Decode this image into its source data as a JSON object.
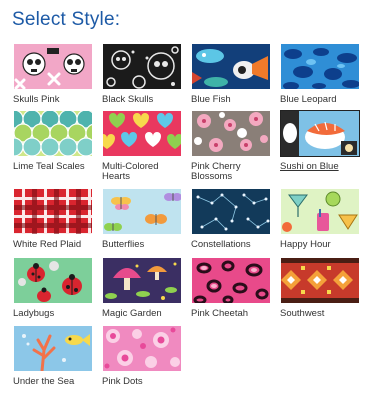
{
  "header": {
    "title": "Select Style:"
  },
  "styles": [
    {
      "label": "Skulls Pink",
      "icon": "skulls-pink-swatch",
      "selected": false
    },
    {
      "label": "Black Skulls",
      "icon": "black-skulls-swatch",
      "selected": false
    },
    {
      "label": "Blue Fish",
      "icon": "blue-fish-swatch",
      "selected": false
    },
    {
      "label": "Blue Leopard",
      "icon": "blue-leopard-swatch",
      "selected": false
    },
    {
      "label": "Lime Teal Scales",
      "icon": "lime-teal-scales-swatch",
      "selected": false
    },
    {
      "label": "Multi-Colored Hearts",
      "icon": "multi-colored-hearts-swatch",
      "selected": false
    },
    {
      "label": "Pink Cherry Blossoms",
      "icon": "pink-cherry-blossoms-swatch",
      "selected": false
    },
    {
      "label": "Sushi on Blue",
      "icon": "sushi-on-blue-swatch",
      "selected": true
    },
    {
      "label": "White Red Plaid",
      "icon": "white-red-plaid-swatch",
      "selected": false
    },
    {
      "label": "Butterflies",
      "icon": "butterflies-swatch",
      "selected": false
    },
    {
      "label": "Constellations",
      "icon": "constellations-swatch",
      "selected": false
    },
    {
      "label": "Happy Hour",
      "icon": "happy-hour-swatch",
      "selected": false
    },
    {
      "label": "Ladybugs",
      "icon": "ladybugs-swatch",
      "selected": false
    },
    {
      "label": "Magic Garden",
      "icon": "magic-garden-swatch",
      "selected": false
    },
    {
      "label": "Pink Cheetah",
      "icon": "pink-cheetah-swatch",
      "selected": false
    },
    {
      "label": "Southwest",
      "icon": "southwest-swatch",
      "selected": false
    },
    {
      "label": "Under the Sea",
      "icon": "under-the-sea-swatch",
      "selected": false
    },
    {
      "label": "Pink Dots",
      "icon": "pink-dots-swatch",
      "selected": false
    }
  ],
  "colors": {
    "title": "#1d5aa6",
    "label": "#333333",
    "selected_border": "#222222"
  }
}
